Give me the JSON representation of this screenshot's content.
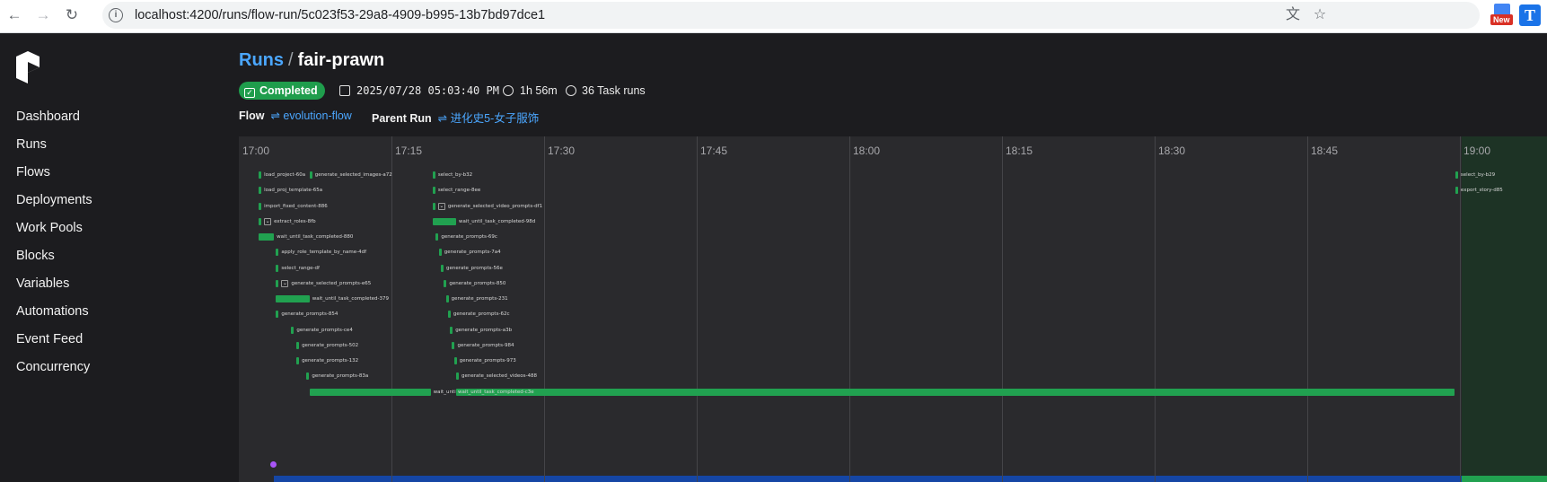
{
  "browser": {
    "url": "localhost:4200/runs/flow-run/5c023f53-29a8-4909-b995-13b7bd97dce1",
    "ext_new_label": "New",
    "ext_t_label": "T"
  },
  "sidebar": {
    "items": [
      {
        "label": "Dashboard"
      },
      {
        "label": "Runs"
      },
      {
        "label": "Flows"
      },
      {
        "label": "Deployments"
      },
      {
        "label": "Work Pools"
      },
      {
        "label": "Blocks"
      },
      {
        "label": "Variables"
      },
      {
        "label": "Automations"
      },
      {
        "label": "Event Feed"
      },
      {
        "label": "Concurrency"
      }
    ]
  },
  "header": {
    "breadcrumb_root": "Runs",
    "separator": "/",
    "run_name": "fair-prawn",
    "state": "Completed",
    "start_time": "2025/07/28 05:03:40 PM",
    "duration": "1h 56m",
    "task_runs": "36 Task runs",
    "flow_label": "Flow",
    "flow_name": "evolution-flow",
    "parent_label": "Parent Run",
    "parent_name": "进化史5-女子服饰"
  },
  "timeline": {
    "hours": [
      "17:00",
      "17:15",
      "17:30",
      "17:45",
      "18:00",
      "18:15",
      "18:30",
      "18:45",
      "19:00"
    ],
    "tasks": [
      {
        "label": "load_project-60a",
        "start_min": 1.6,
        "dur_min": 0.2,
        "row": 0
      },
      {
        "label": "generate_selected_images-a72",
        "start_min": 6.6,
        "dur_min": 0.2,
        "row": 0
      },
      {
        "label": "load_proj_template-65a",
        "start_min": 1.6,
        "dur_min": 0.2,
        "row": 1
      },
      {
        "label": "import_fixed_content-886",
        "start_min": 1.6,
        "dur_min": 0.2,
        "row": 2
      },
      {
        "label": "extract_roles-8fb",
        "start_min": 1.6,
        "dur_min": 0.2,
        "row": 3,
        "expand": true
      },
      {
        "label": "wait_until_task_completed-880",
        "start_min": 1.6,
        "dur_min": 1.5,
        "row": 4
      },
      {
        "label": "apply_role_template_by_name-4df",
        "start_min": 3.3,
        "dur_min": 0.2,
        "row": 5
      },
      {
        "label": "select_range-df",
        "start_min": 3.3,
        "dur_min": 0.2,
        "row": 6
      },
      {
        "label": "generate_selected_prompts-e65",
        "start_min": 3.3,
        "dur_min": 0.2,
        "row": 7,
        "expand": true
      },
      {
        "label": "wait_until_task_completed-379",
        "start_min": 3.3,
        "dur_min": 3.3,
        "row": 8
      },
      {
        "label": "generate_prompts-854",
        "start_min": 3.3,
        "dur_min": 0.2,
        "row": 9
      },
      {
        "label": "generate_prompts-ce4",
        "start_min": 4.8,
        "dur_min": 0.2,
        "row": 10
      },
      {
        "label": "generate_prompts-502",
        "start_min": 5.3,
        "dur_min": 0.2,
        "row": 11
      },
      {
        "label": "generate_prompts-132",
        "start_min": 5.3,
        "dur_min": 0.2,
        "row": 12
      },
      {
        "label": "generate_prompts-83a",
        "start_min": 6.3,
        "dur_min": 0.2,
        "row": 13
      },
      {
        "label": "wait_until_task_completed-ab8",
        "start_min": 6.6,
        "dur_min": 11.9,
        "row": 14
      },
      {
        "label": "select_by-b32",
        "start_min": 18.7,
        "dur_min": 0.2,
        "row": 0
      },
      {
        "label": "select_range-8ee",
        "start_min": 18.7,
        "dur_min": 0.2,
        "row": 1
      },
      {
        "label": "generate_selected_video_prompts-df1",
        "start_min": 18.7,
        "dur_min": 0.2,
        "row": 2,
        "expand": true
      },
      {
        "label": "wait_until_task_completed-98d",
        "start_min": 18.7,
        "dur_min": 2.3,
        "row": 3
      },
      {
        "label": "generate_prompts-69c",
        "start_min": 19.0,
        "dur_min": 0.2,
        "row": 4
      },
      {
        "label": "generate_prompts-7a4",
        "start_min": 19.3,
        "dur_min": 0.2,
        "row": 5
      },
      {
        "label": "generate_prompts-56e",
        "start_min": 19.5,
        "dur_min": 0.2,
        "row": 6
      },
      {
        "label": "generate_prompts-850",
        "start_min": 19.8,
        "dur_min": 0.2,
        "row": 7
      },
      {
        "label": "generate_prompts-231",
        "start_min": 20.0,
        "dur_min": 0.2,
        "row": 8
      },
      {
        "label": "generate_prompts-62c",
        "start_min": 20.2,
        "dur_min": 0.2,
        "row": 9
      },
      {
        "label": "generate_prompts-a3b",
        "start_min": 20.4,
        "dur_min": 0.2,
        "row": 10
      },
      {
        "label": "generate_prompts-984",
        "start_min": 20.6,
        "dur_min": 0.2,
        "row": 11
      },
      {
        "label": "generate_prompts-973",
        "start_min": 20.8,
        "dur_min": 0.2,
        "row": 12
      },
      {
        "label": "generate_selected_videos-488",
        "start_min": 21.0,
        "dur_min": 0.2,
        "row": 13
      },
      {
        "label": "wait_until_task_completed-c3e",
        "start_min": 21.0,
        "dur_min": 98.1,
        "row": 14,
        "inside": true
      },
      {
        "label": "select_by-b29",
        "start_min": 119.2,
        "dur_min": 0.2,
        "row": 0
      },
      {
        "label": "export_story-d85",
        "start_min": 119.2,
        "dur_min": 0.2,
        "row": 1
      }
    ]
  },
  "colors": {
    "accent": "#4ba7ff",
    "completed": "#1f9d4c",
    "task_bar": "#21a150",
    "flow_bar": "#1546a5",
    "now_marker": "#a855f7"
  }
}
